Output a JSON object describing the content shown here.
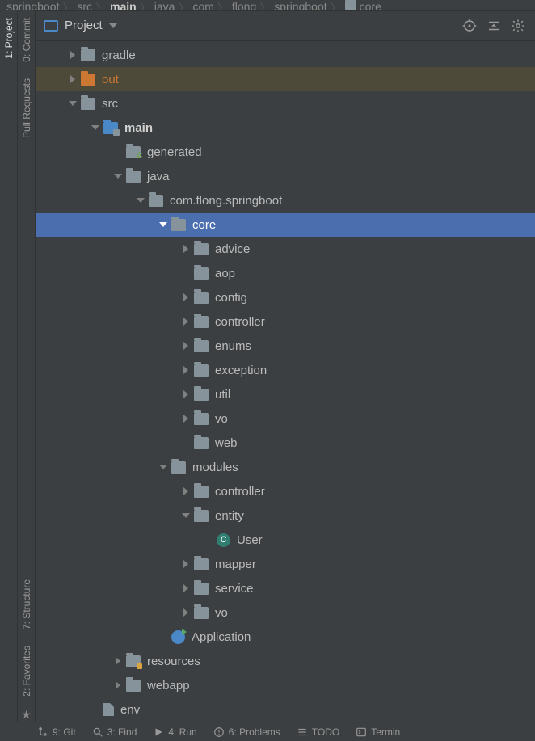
{
  "breadcrumb": [
    "springboot",
    "src",
    "main",
    "java",
    "com",
    "flong",
    "springboot",
    "core"
  ],
  "breadcrumb_bold_index": 2,
  "project": {
    "header": {
      "title": "Project"
    },
    "tree": [
      {
        "depth": 0,
        "chev": "collapsed",
        "icon": "folder",
        "label": "gradle"
      },
      {
        "depth": 0,
        "chev": "collapsed",
        "icon": "folder-out",
        "label": "out",
        "label_class": "orange",
        "row_class": "bg-hl"
      },
      {
        "depth": 0,
        "chev": "expanded",
        "icon": "folder",
        "label": "src"
      },
      {
        "depth": 1,
        "chev": "expanded",
        "icon": "folder-src",
        "label": "main",
        "label_class": "bold"
      },
      {
        "depth": 2,
        "chev": "none",
        "icon": "folder-gen",
        "label": "generated"
      },
      {
        "depth": 2,
        "chev": "expanded",
        "icon": "folder",
        "label": "java"
      },
      {
        "depth": 3,
        "chev": "expanded",
        "icon": "folder",
        "label": "com.flong.springboot"
      },
      {
        "depth": 4,
        "chev": "expanded",
        "icon": "folder",
        "label": "core",
        "row_class": "selected"
      },
      {
        "depth": 5,
        "chev": "collapsed",
        "icon": "folder",
        "label": "advice"
      },
      {
        "depth": 5,
        "chev": "none",
        "icon": "folder",
        "label": "aop"
      },
      {
        "depth": 5,
        "chev": "collapsed",
        "icon": "folder",
        "label": "config"
      },
      {
        "depth": 5,
        "chev": "collapsed",
        "icon": "folder",
        "label": "controller"
      },
      {
        "depth": 5,
        "chev": "collapsed",
        "icon": "folder",
        "label": "enums"
      },
      {
        "depth": 5,
        "chev": "collapsed",
        "icon": "folder",
        "label": "exception"
      },
      {
        "depth": 5,
        "chev": "collapsed",
        "icon": "folder",
        "label": "util"
      },
      {
        "depth": 5,
        "chev": "collapsed",
        "icon": "folder",
        "label": "vo"
      },
      {
        "depth": 5,
        "chev": "none",
        "icon": "folder",
        "label": "web"
      },
      {
        "depth": 4,
        "chev": "expanded",
        "icon": "folder",
        "label": "modules"
      },
      {
        "depth": 5,
        "chev": "collapsed",
        "icon": "folder",
        "label": "controller"
      },
      {
        "depth": 5,
        "chev": "expanded",
        "icon": "folder",
        "label": "entity"
      },
      {
        "depth": 6,
        "chev": "none",
        "icon": "class",
        "label": "User"
      },
      {
        "depth": 5,
        "chev": "collapsed",
        "icon": "folder",
        "label": "mapper"
      },
      {
        "depth": 5,
        "chev": "collapsed",
        "icon": "folder",
        "label": "service"
      },
      {
        "depth": 5,
        "chev": "collapsed",
        "icon": "folder",
        "label": "vo"
      },
      {
        "depth": 4,
        "chev": "none",
        "icon": "run",
        "label": "Application"
      },
      {
        "depth": 2,
        "chev": "collapsed",
        "icon": "folder-res",
        "label": "resources"
      },
      {
        "depth": 2,
        "chev": "collapsed",
        "icon": "folder",
        "label": "webapp"
      },
      {
        "depth": 1,
        "chev": "none",
        "icon": "file",
        "label": "env"
      }
    ]
  },
  "left_tabs": {
    "project": "1: Project",
    "commit": "0: Commit",
    "pull_requests": "Pull Requests",
    "structure": "7: Structure",
    "favorites": "2: Favorites"
  },
  "status_bar": {
    "git": "9: Git",
    "find": "3: Find",
    "run": "4: Run",
    "problems": "6: Problems",
    "todo": "TODO",
    "terminal": "Termin"
  }
}
